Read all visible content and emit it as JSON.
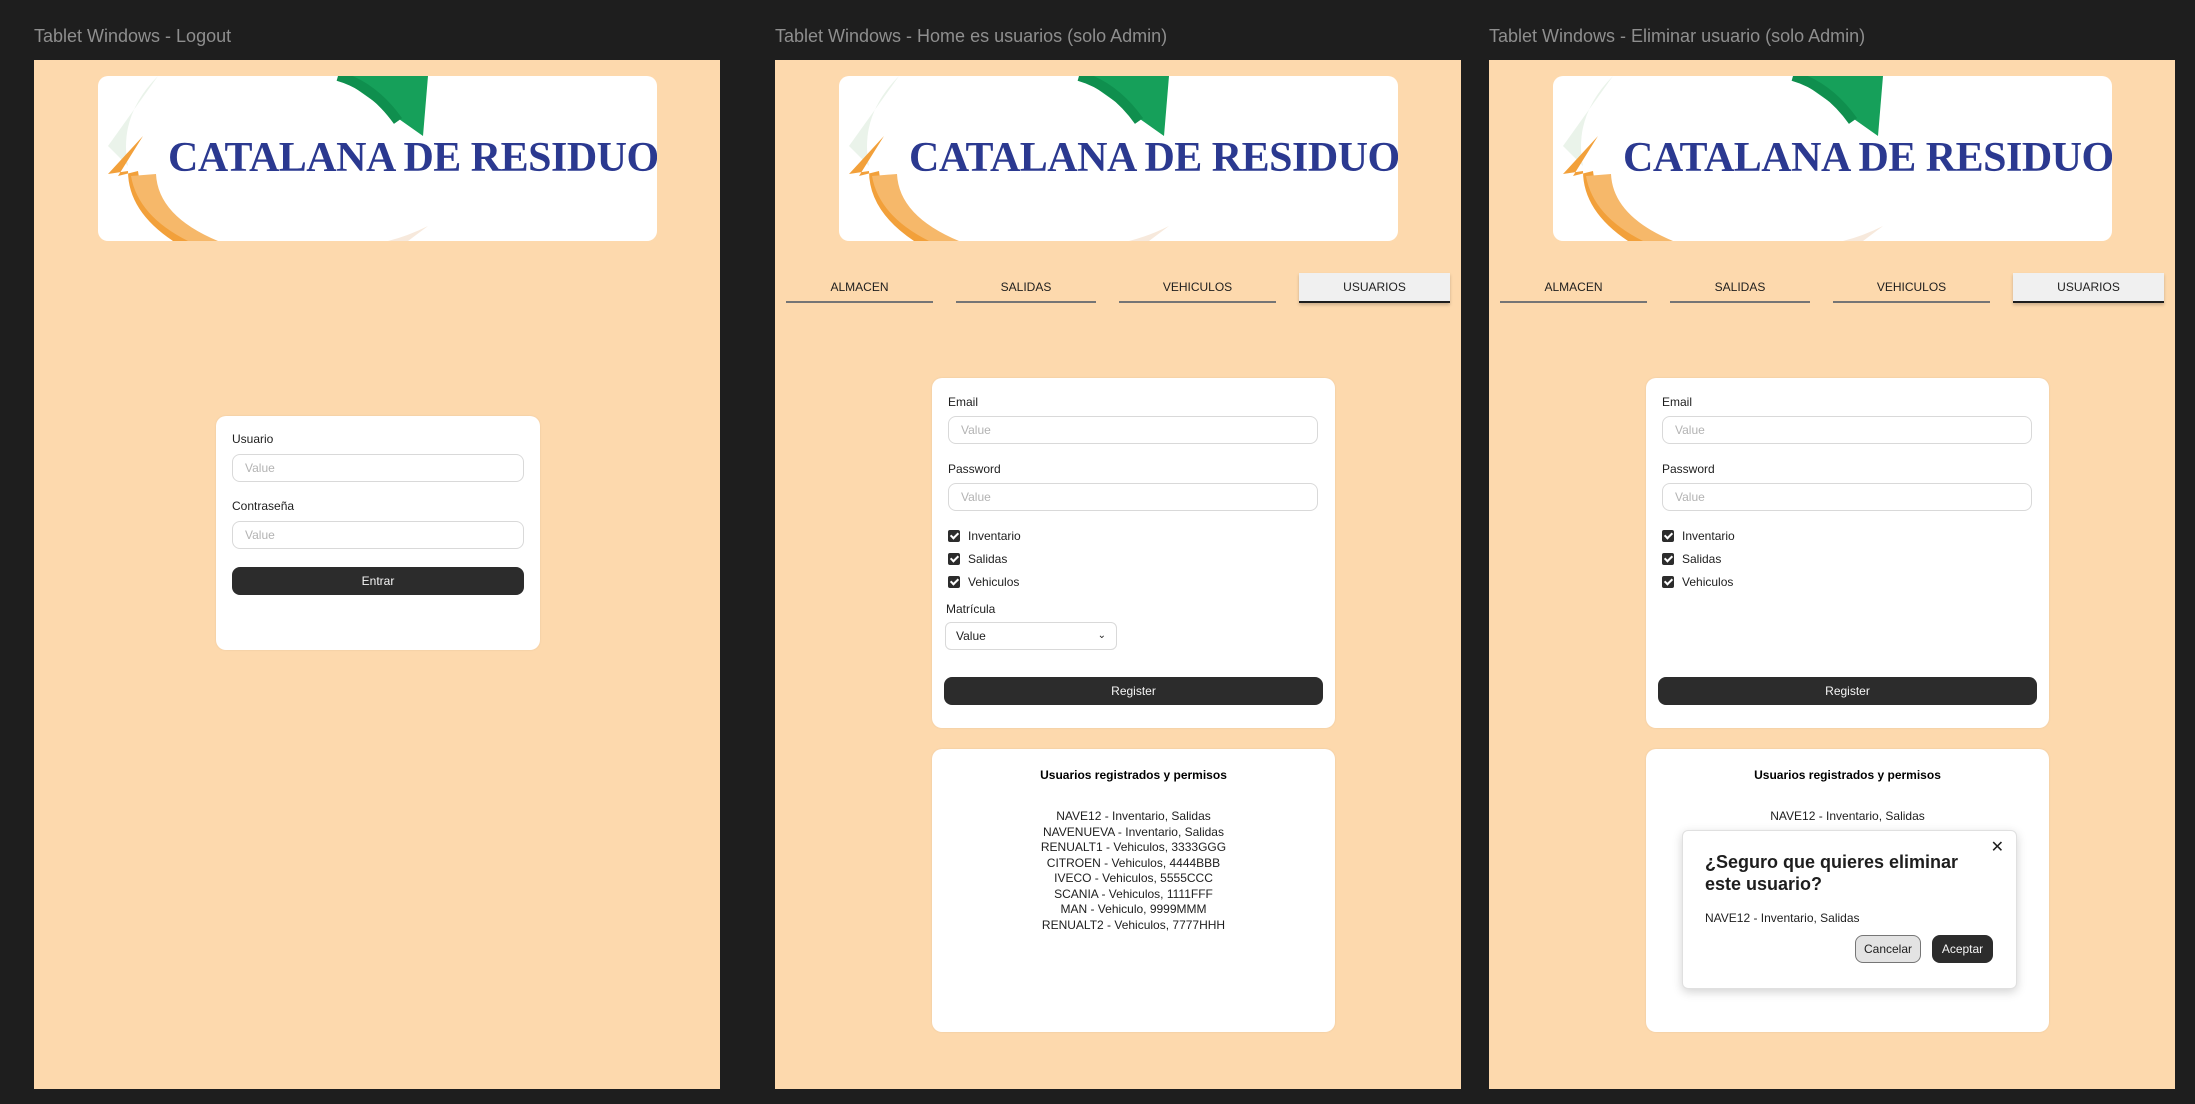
{
  "frames": [
    {
      "title": "Tablet Windows - Logout"
    },
    {
      "title": "Tablet Windows - Home es usuarios (solo Admin)"
    },
    {
      "title": "Tablet Windows - Eliminar usuario (solo Admin)"
    }
  ],
  "brand": {
    "company": "CATALANA DE RESIDUOS, S.L.U"
  },
  "colors": {
    "page_bg": "#fdd9ad",
    "canvas_bg": "#1e1e1e",
    "button_dark": "#2c2c2c",
    "logo_text": "#2b3990"
  },
  "login": {
    "user_label": "Usuario",
    "user_placeholder": "Value",
    "password_label": "Contraseña",
    "password_placeholder": "Value",
    "submit": "Entrar"
  },
  "nav": {
    "tabs": [
      "ALMACEN",
      "SALIDAS",
      "VEHICULOS",
      "USUARIOS"
    ],
    "active": "USUARIOS"
  },
  "register": {
    "email_label": "Email",
    "email_placeholder": "Value",
    "password_label": "Password",
    "password_placeholder": "Value",
    "permissions": [
      "Inventario",
      "Salidas",
      "Vehiculos"
    ],
    "matricula_label": "Matrícula",
    "matricula_value": "Value",
    "submit": "Register"
  },
  "users": {
    "title": "Usuarios registrados y permisos",
    "items": [
      "NAVE12 - Inventario, Salidas",
      "NAVENUEVA - Inventario, Salidas",
      "RENUALT1 - Vehiculos, 3333GGG",
      "CITROEN - Vehiculos, 4444BBB",
      "IVECO - Vehiculos, 5555CCC",
      "SCANIA - Vehiculos, 1111FFF",
      "MAN - Vehiculo, 9999MMM",
      "RENUALT2 - Vehiculos, 7777HHH"
    ]
  },
  "delete_dialog": {
    "title": "¿Seguro que quieres eliminar este usuario?",
    "body": "NAVE12 - Inventario, Salidas",
    "cancel": "Cancelar",
    "accept": "Aceptar",
    "close_icon": "close-icon"
  }
}
